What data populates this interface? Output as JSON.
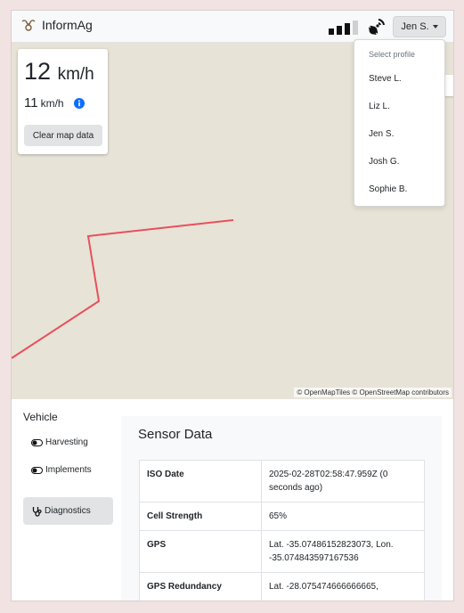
{
  "app": {
    "name": "InformAg"
  },
  "navbar": {
    "profile_button": "Jen S."
  },
  "speed": {
    "primary_value": "12",
    "primary_unit": "km/h",
    "secondary_value": "11",
    "secondary_unit": "km/h",
    "clear_button": "Clear map data"
  },
  "map": {
    "attribution": "© OpenMapTiles © OpenStreetMap contributors",
    "track_color": "#e8505b"
  },
  "profile_menu": {
    "header": "Select profile",
    "items": [
      "Steve L.",
      "Liz L.",
      "Jen S.",
      "Josh G.",
      "Sophie B."
    ]
  },
  "sidebar": {
    "title": "Vehicle",
    "items": [
      {
        "label": "Harvesting",
        "icon": "toggle-icon"
      },
      {
        "label": "Implements",
        "icon": "toggle-icon"
      }
    ],
    "diagnostics": {
      "label": "Diagnostics",
      "icon": "stethoscope-icon"
    }
  },
  "sensor": {
    "title": "Sensor Data",
    "rows": [
      {
        "key": "ISO Date",
        "value": "2025-02-28T02:58:47.959Z (0 seconds ago)"
      },
      {
        "key": "Cell Strength",
        "value": "65%"
      },
      {
        "key": "GPS",
        "value": "Lat. -35.07486152823073, Lon. -35.074843597167536"
      },
      {
        "key": "GPS Redundancy",
        "value": "Lat. -28.075474666666665,"
      }
    ]
  },
  "colors": {
    "accent_info": "#0d6efd",
    "track": "#e8505b"
  }
}
